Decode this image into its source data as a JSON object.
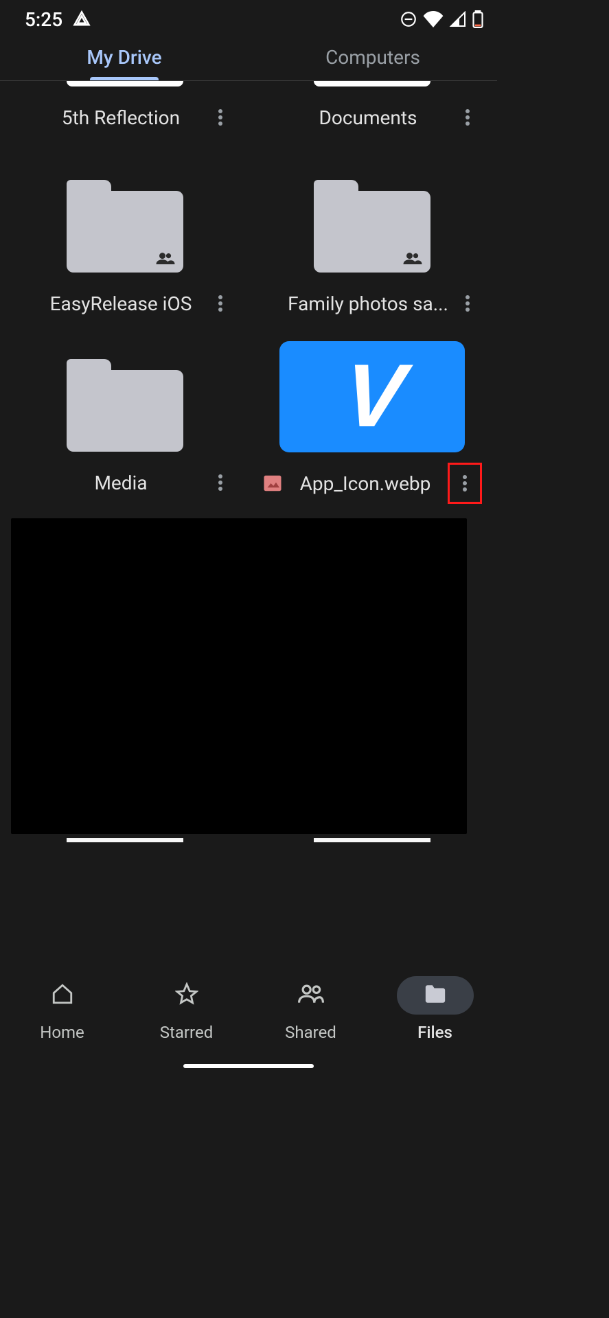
{
  "status": {
    "time": "5:25",
    "icons": {
      "left_warning": "triangle-warning-icon",
      "dnd": "do-not-disturb-icon",
      "wifi": "wifi-icon",
      "signal": "cell-signal-icon",
      "battery": "battery-low-icon"
    }
  },
  "tabs": {
    "my_drive": "My Drive",
    "computers": "Computers",
    "active": "my_drive"
  },
  "items": {
    "partial": [
      {
        "name": "5th Reflection"
      },
      {
        "name": "Documents"
      }
    ],
    "folders": [
      {
        "name": "EasyRelease iOS",
        "shared": true
      },
      {
        "name": "Family photos sa...",
        "shared": true
      },
      {
        "name": "Media",
        "shared": false
      }
    ],
    "files": [
      {
        "name": "App_Icon.webp",
        "type": "image",
        "highlighted_menu": true
      }
    ]
  },
  "nav": {
    "home": "Home",
    "starred": "Starred",
    "shared": "Shared",
    "files": "Files",
    "active": "files"
  },
  "colors": {
    "accent": "#a8c7fa",
    "bg": "#1a1a1a",
    "folder": "#c4c5cc",
    "highlight": "#ff1a1a",
    "venmo_blue": "#1a8cff"
  }
}
